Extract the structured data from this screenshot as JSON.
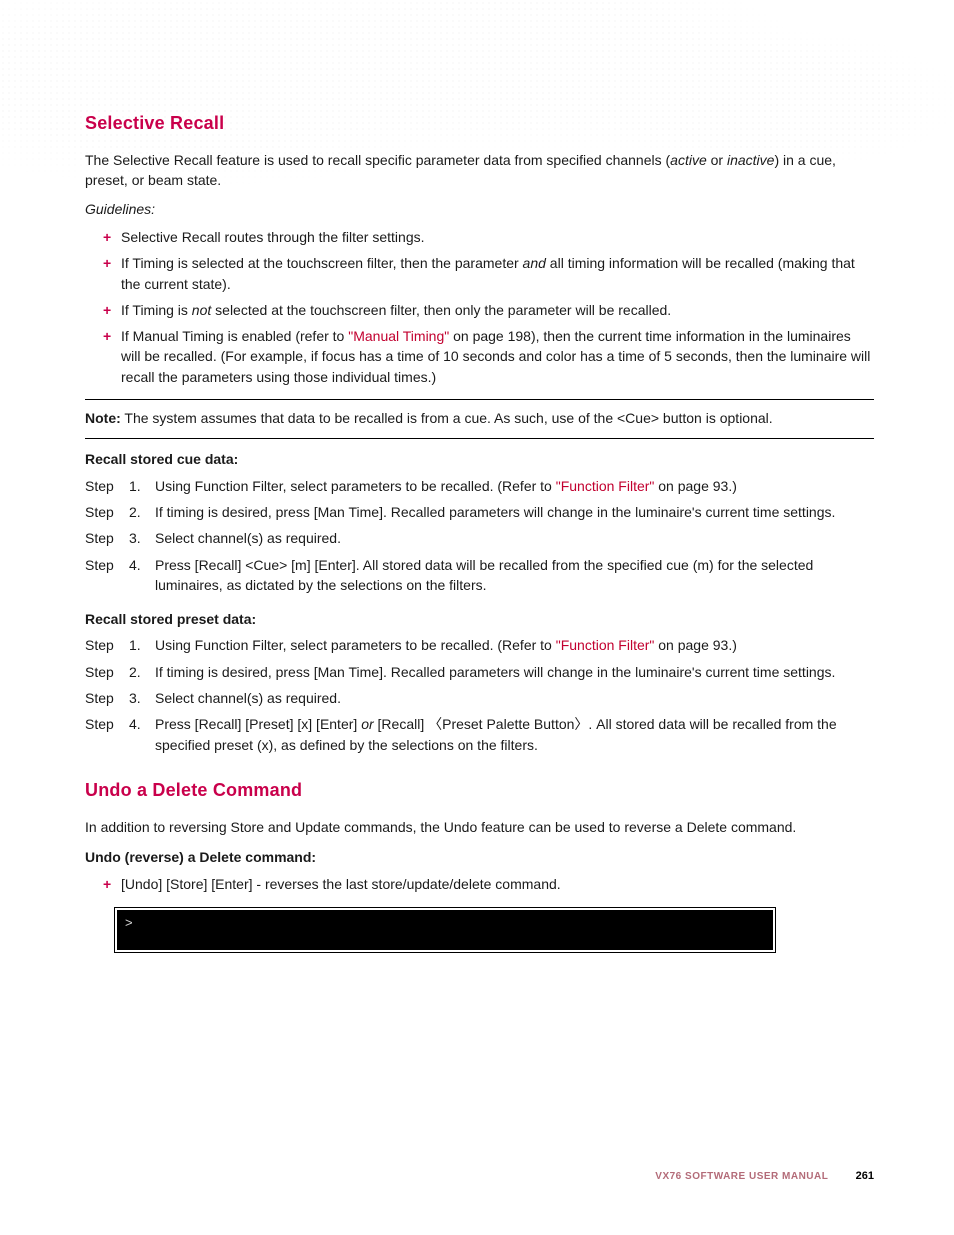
{
  "section1": {
    "title": "Selective Recall",
    "intro_a": "The Selective Recall feature is used to recall specific parameter data from specified channels (",
    "intro_active": "active",
    "intro_b": " or ",
    "intro_inactive": "inactive",
    "intro_c": ") in a cue, preset, or beam state.",
    "guidelines_label": "Guidelines:",
    "bullets": {
      "b1": "Selective Recall routes through the filter settings.",
      "b2a": "If Timing is selected at the touchscreen filter, then the parameter ",
      "b2_and": "and",
      "b2b": " all timing information will be recalled (making that the current state).",
      "b3a": "If Timing is ",
      "b3_not": "not",
      "b3b": " selected at the touchscreen filter, then only the parameter will be recalled.",
      "b4a": "If Manual Timing is enabled (refer to ",
      "b4_link": "\"Manual Timing\"",
      "b4b": " on page 198), then the current time information in the luminaires will be recalled. (For example, if focus has a time of 10 seconds and color has a time of 5 seconds, then the luminaire will recall the parameters using those individual times.)"
    },
    "note_label": "Note:",
    "note_text": "  The system assumes that data to be recalled is from a cue. As such, use of the <Cue> button is optional.",
    "cue_heading": "Recall stored cue data:",
    "step_label": "Step",
    "cue_steps": {
      "s1a": "Using Function Filter, select parameters to be recalled. (Refer to ",
      "s1_link": "\"Function Filter\"",
      "s1b": " on page 93.)",
      "s2": "If timing is desired, press [Man Time]. Recalled parameters will change in the luminaire's current time settings.",
      "s3": "Select channel(s) as required.",
      "s4": "Press [Recall] <Cue> [m] [Enter]. All stored data will be recalled from the specified cue (m) for the selected luminaires, as dictated by the selections on the filters."
    },
    "preset_heading": "Recall stored preset data:",
    "preset_steps": {
      "s1a": "Using Function Filter, select parameters to be recalled. (Refer to ",
      "s1_link": "\"Function Filter\"",
      "s1b": " on page 93.)",
      "s2": "If timing is desired, press [Man Time]. Recalled parameters will change in the luminaire's current time settings.",
      "s3": "Select channel(s) as required.",
      "s4a": "Press [Recall] [Preset] [x] [Enter] ",
      "s4_or": "or",
      "s4b": " [Recall] 〈Preset Palette Button〉. All stored data will be recalled from the specified preset (x), as defined by the selections on the filters."
    }
  },
  "section2": {
    "title": "Undo a Delete Command",
    "intro": "In addition to reversing Store and Update commands, the Undo feature can be used to reverse a Delete command.",
    "subhead": "Undo (reverse) a Delete command:",
    "bullet": "[Undo] [Store] [Enter] - reverses the last store/update/delete command.",
    "prompt": ">"
  },
  "nums": {
    "n1": "1.",
    "n2": "2.",
    "n3": "3.",
    "n4": "4."
  },
  "footer": {
    "title": "VX76 SOFTWARE USER MANUAL",
    "page": "261"
  }
}
